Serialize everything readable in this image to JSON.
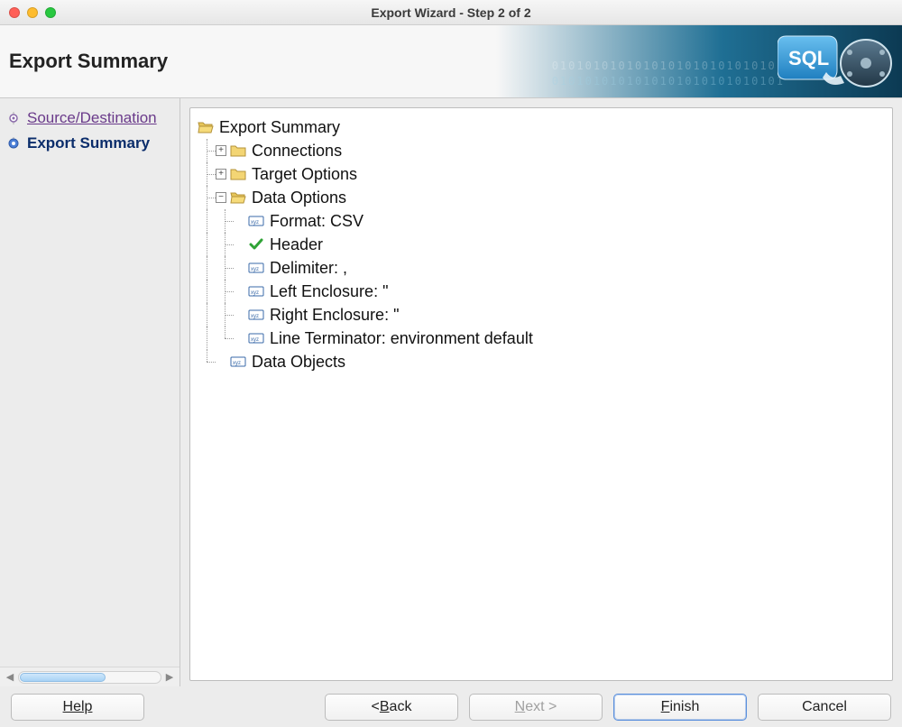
{
  "window": {
    "title": "Export Wizard - Step 2 of 2"
  },
  "header": {
    "title": "Export Summary",
    "binary_text": "0101010101010101010101010101"
  },
  "sidebar": {
    "steps": [
      {
        "label": "Source/Destination",
        "state": "visited"
      },
      {
        "label": "Export Summary",
        "state": "current"
      }
    ]
  },
  "tree": {
    "root": {
      "label": "Export Summary",
      "icon": "folder-open",
      "children": [
        {
          "label": "Connections",
          "icon": "folder-closed",
          "expand": "plus"
        },
        {
          "label": "Target Options",
          "icon": "folder-closed",
          "expand": "plus"
        },
        {
          "label": "Data Options",
          "icon": "folder-open",
          "expand": "minus",
          "children": [
            {
              "label": "Format: CSV",
              "icon": "xyz"
            },
            {
              "label": "Header",
              "icon": "check"
            },
            {
              "label": "Delimiter: ,",
              "icon": "xyz"
            },
            {
              "label": "Left Enclosure: \"",
              "icon": "xyz"
            },
            {
              "label": "Right Enclosure: \"",
              "icon": "xyz"
            },
            {
              "label": "Line Terminator: environment default",
              "icon": "xyz"
            }
          ]
        },
        {
          "label": "Data Objects",
          "icon": "xyz"
        }
      ]
    }
  },
  "footer": {
    "help": "Help",
    "back_prefix": "< ",
    "back_accel": "B",
    "back_suffix": "ack",
    "next_accel": "N",
    "next_suffix": "ext >",
    "finish_accel": "F",
    "finish_suffix": "inish",
    "cancel": "Cancel"
  }
}
